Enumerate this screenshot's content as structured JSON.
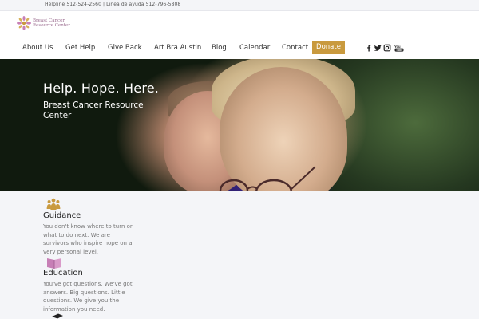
{
  "topbar": {
    "helpline": "Helpline 512-524-2560 | Linea de ayuda 512-796-5808"
  },
  "logo": {
    "line1": "Breast Cancer",
    "line2": "Resource Center"
  },
  "nav": {
    "items": [
      "About Us",
      "Get Help",
      "Give Back",
      "Art Bra Austin",
      "Blog",
      "Calendar",
      "Contact"
    ],
    "donate": "Donate",
    "social": [
      "facebook-icon",
      "twitter-icon",
      "instagram-icon",
      "youtube-icon"
    ]
  },
  "hero": {
    "title": "Help. Hope. Here.",
    "subtitle": "Breast Cancer Resource Center"
  },
  "features": [
    {
      "icon": "group-icon",
      "icon_color": "#c99a3e",
      "title": "Guidance",
      "text": "You don't know where to turn or what to do next. We are survivors who inspire hope on a very personal level."
    },
    {
      "icon": "book-icon",
      "icon_color": "#c77fb6",
      "title": "Education",
      "text": "You've got questions. We've got answers. Big questions. Little questions. We give you the information you need."
    }
  ],
  "colors": {
    "accent": "#c99a3e",
    "text": "#333333",
    "muted": "#777777"
  }
}
